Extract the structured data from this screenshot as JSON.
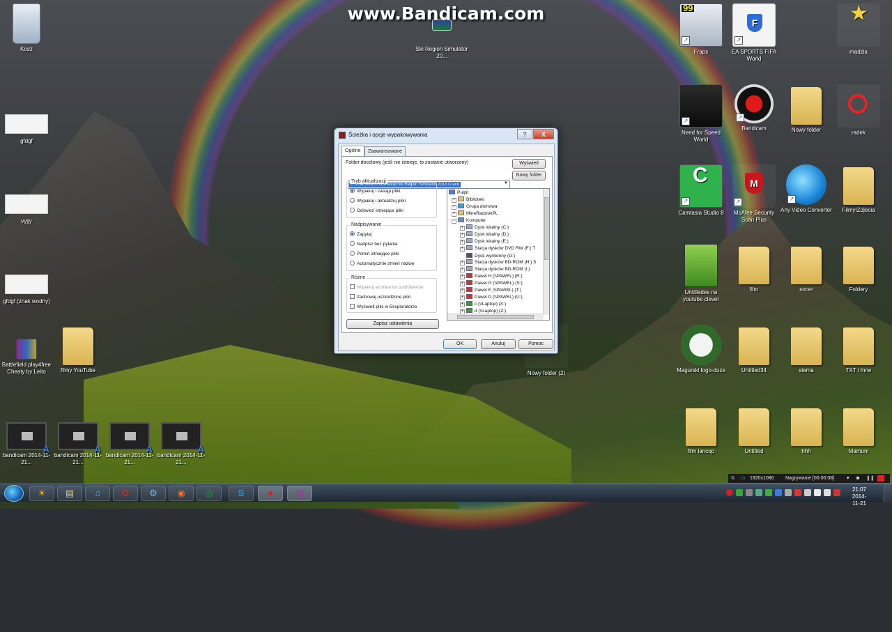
{
  "watermark": "www.Bandicam.com",
  "desktop_icons": {
    "kosz": "Kosz",
    "ski_region": "Ski Region Simulator 20...",
    "gfdgf": "gfdgf",
    "vyjjy": "vyjjy",
    "gfdgf_znak": "gfdgf (znak wodny)",
    "battlefield": "Battlefield play4free Cheaty by Leito",
    "filmy_youtube": "filmy YouTube",
    "bandicam1": "bandicam 2014-11-21...",
    "bandicam2": "bandicam 2014-11-21...",
    "bandicam3": "bandicam 2014-11-21...",
    "bandicam4": "bandicam 2014-11-21...",
    "fraps": "Fraps",
    "fifa": "EA SPORTS FIFA World",
    "madzia": "madzia",
    "nfs": "Need for Speed World",
    "bandicam_app": "Bandicam",
    "nowy_folder": "Nowy folder",
    "radek": "radek",
    "camtasia": "Camtasia Studio 8",
    "mcafee": "McAfee Security Scan Plus",
    "any_video": "Any Video Converter",
    "filmyizdjecia": "FilmyIZdjecia",
    "untitledes": "Untitledes na youtube clever",
    "film": "film",
    "socer": "socer",
    "foldery": "Foldery",
    "nowy_folder_2": "Nowy folder (2)",
    "magurski": "Magurski logo-duze",
    "untitled34": "Untitled34",
    "siema": "siema",
    "txt_inne": "TXT i Inne",
    "film_lancop": "film lancop",
    "untitled": "Untitled",
    "hhh": "hhh",
    "mamuni": "Mamuni"
  },
  "dialog": {
    "title": "Ścieżka i opcje wypakowywania",
    "help_btn": "?",
    "close_btn": "X",
    "tabs": [
      "Ogólne",
      "Zaawansowane"
    ],
    "dest_label": "Folder docelowy (jeśli nie istnieje, to zostanie utworzony)",
    "dest_value": "C:\\Users\\Admin\\Desktop\\Ski Region Simulator 2013 Crack",
    "show_btn": "Wyświetl",
    "new_folder_btn": "Nowy folder",
    "update_mode": {
      "title": "Tryb aktualizacji",
      "options": [
        "Wypakuj i zastąp pliki",
        "Wypakuj i aktualizuj pliki",
        "Odśwież istniejące pliki"
      ],
      "selected": 0
    },
    "overwrite": {
      "title": "Nadpisywanie",
      "options": [
        "Zapytaj",
        "Nadpisz bez pytania",
        "Pomiń istniejące pliki",
        "Automatycznie zmień nazwę"
      ],
      "selected": 0
    },
    "misc": {
      "title": "Różne",
      "options": [
        "Wypakuj archiwa do podfolderów",
        "Zachowaj uszkodzone pliki",
        "Wyświetl pliki w Eksploratorze"
      ]
    },
    "save_btn": "Zapisz ustawienia",
    "tree": [
      "Pulpit",
      "Biblioteki",
      "Grupa domowa",
      "MineRadziokPL",
      "Komputer",
      "Dysk lokalny (C:)",
      "Dysk lokalny (D:)",
      "Dysk lokalny (E:)",
      "Stacja dysków DVD RW (F:) T",
      "Dysk wymienny (G:)",
      "Stacja dysków BD-ROM (H:) S",
      "Stacja dysków BD-ROM (I:)",
      "Pawel H (\\\\PAWEL) (R:)",
      "Pawel G (\\\\PAWEL) (S:)",
      "Pawel E (\\\\PAWEL) (T:)",
      "Pawel D (\\\\PAWEL) (U:)",
      "c (\\\\Laptop) (X:)",
      "d (\\\\Laptop) (Z:)"
    ],
    "ok_btn": "OK",
    "cancel_btn": "Anuluj",
    "help_text_btn": "Pomoc"
  },
  "recorder": {
    "resolution": "1920x1080",
    "status": "Nagrywanie [00:00:08]"
  },
  "clock": {
    "time": "21:07",
    "date": "2014-11-21"
  }
}
